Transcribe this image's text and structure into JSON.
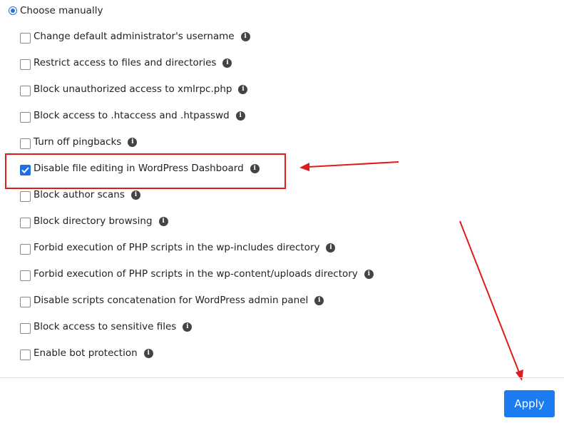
{
  "mode": {
    "label": "Choose manually",
    "selected": true
  },
  "options": [
    {
      "label": "Change default administrator's username",
      "checked": false
    },
    {
      "label": "Restrict access to files and directories",
      "checked": false
    },
    {
      "label": "Block unauthorized access to xmlrpc.php",
      "checked": false
    },
    {
      "label": "Block access to .htaccess and .htpasswd",
      "checked": false
    },
    {
      "label": "Turn off pingbacks",
      "checked": false
    },
    {
      "label": "Disable file editing in WordPress Dashboard",
      "checked": true
    },
    {
      "label": "Block author scans",
      "checked": false
    },
    {
      "label": "Block directory browsing",
      "checked": false
    },
    {
      "label": "Forbid execution of PHP scripts in the wp-includes directory",
      "checked": false
    },
    {
      "label": "Forbid execution of PHP scripts in the wp-content/uploads directory",
      "checked": false
    },
    {
      "label": "Disable scripts concatenation for WordPress admin panel",
      "checked": false
    },
    {
      "label": "Block access to sensitive files",
      "checked": false
    },
    {
      "label": "Enable bot protection",
      "checked": false
    }
  ],
  "info_icon": {
    "name": "info-icon",
    "glyph": "i"
  },
  "footer": {
    "apply_label": "Apply"
  },
  "colors": {
    "accent": "#1a7cf0",
    "checkbox_checked": "#1f6fdc",
    "annotation": "#e01b1b",
    "info_icon": "#444444"
  }
}
